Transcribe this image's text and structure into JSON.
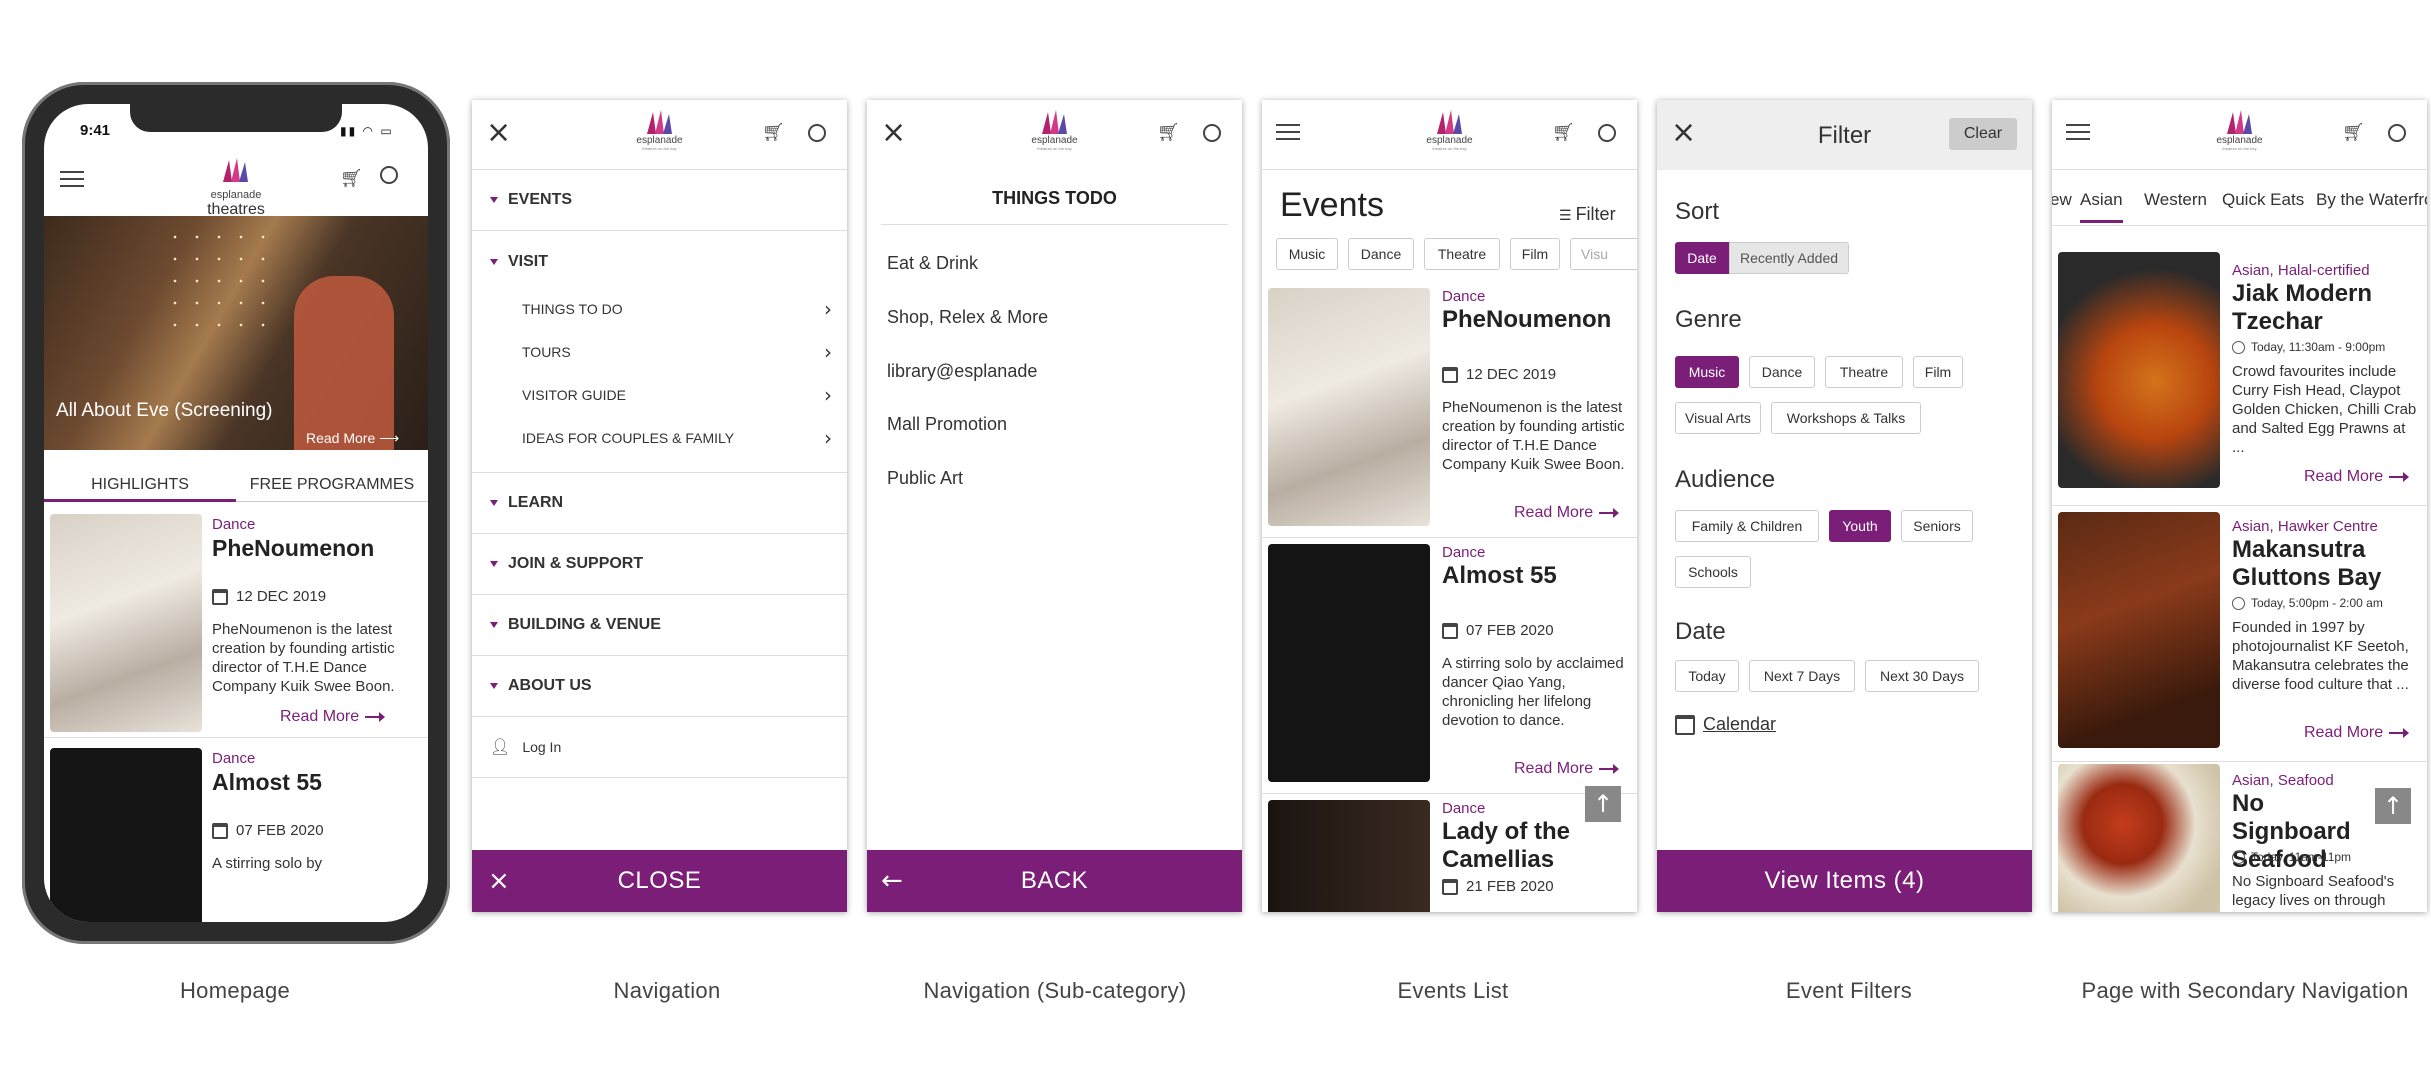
{
  "colors": {
    "accent": "#7a1e78",
    "chip_border": "#cccccc",
    "to_top": "#888888"
  },
  "logo": {
    "name": "esplanade",
    "sub1": "theatres on the bay",
    "sub2": "singapore"
  },
  "captions": [
    "Homepage",
    "Navigation",
    "Navigation (Sub-category)",
    "Events List",
    "Event Filters",
    "Page with Secondary Navigation"
  ],
  "home": {
    "status_time": "9:41",
    "hero_title": "All About Eve (Screening)",
    "hero_read_more": "Read More",
    "tabs": [
      "HIGHLIGHTS",
      "FREE PROGRAMMES"
    ],
    "cards": [
      {
        "category": "Dance",
        "title": "PheNoumenon",
        "date": "12 DEC 2019",
        "desc": "PheNoumenon is the latest creation by founding artistic director of T.H.E Dance Company Kuik Swee Boon.",
        "read_more": "Read More"
      },
      {
        "category": "Dance",
        "title": "Almost 55",
        "date": "07 FEB 2020",
        "desc": "A stirring solo by"
      }
    ]
  },
  "nav": {
    "sections": [
      "EVENTS",
      "VISIT",
      "LEARN",
      "JOIN & SUPPORT",
      "BUILDING & VENUE",
      "ABOUT US"
    ],
    "visit_items": [
      "THINGS TO DO",
      "TOURS",
      "VISITOR GUIDE",
      "IDEAS FOR COUPLES & FAMILY"
    ],
    "login": "Log In",
    "close": "CLOSE"
  },
  "subnav": {
    "title": "THINGS TODO",
    "items": [
      "Eat & Drink",
      "Shop, Relex & More",
      "library@esplanade",
      "Mall Promotion",
      "Public Art"
    ],
    "back": "BACK"
  },
  "events": {
    "title": "Events",
    "filter_label": "Filter",
    "chips": [
      "Music",
      "Dance",
      "Theatre",
      "Film",
      "Visu"
    ],
    "cards": [
      {
        "category": "Dance",
        "title": "PheNoumenon",
        "date": "12 DEC 2019",
        "desc": "PheNoumenon is the latest creation by founding artistic director of T.H.E Dance Company Kuik Swee Boon.",
        "read_more": "Read More"
      },
      {
        "category": "Dance",
        "title": "Almost 55",
        "date": "07 FEB 2020",
        "desc": "A stirring solo by acclaimed dancer Qiao Yang, chronicling her lifelong devotion to dance.",
        "read_more": "Read More"
      },
      {
        "category": "Dance",
        "title": "Lady of the Camellias",
        "date": "21 FEB 2020"
      }
    ]
  },
  "filter": {
    "title": "Filter",
    "clear": "Clear",
    "sort_title": "Sort",
    "sort": [
      "Date",
      "Recently Added"
    ],
    "genre_title": "Genre",
    "genre": [
      "Music",
      "Dance",
      "Theatre",
      "Film",
      "Visual Arts",
      "Workshops & Talks"
    ],
    "audience_title": "Audience",
    "audience": [
      "Family & Children",
      "Youth",
      "Seniors",
      "Schools"
    ],
    "date_title": "Date",
    "dates": [
      "Today",
      "Next 7 Days",
      "Next 30 Days"
    ],
    "calendar": "Calendar",
    "view": "View Items (4)"
  },
  "dining": {
    "tabs": [
      "ew",
      "Asian",
      "Western",
      "Quick Eats",
      "By the Waterfro"
    ],
    "cards": [
      {
        "category": "Asian, Halal-certified",
        "title": "Jiak Modern Tzechar",
        "time": "Today, 11:30am - 9:00pm",
        "desc": "Crowd favourites include Curry Fish Head, Claypot Golden Chicken, Chilli Crab and Salted Egg Prawns at ...",
        "read_more": "Read More"
      },
      {
        "category": "Asian, Hawker Centre",
        "title": "Makansutra Gluttons Bay",
        "time": "Today, 5:00pm - 2:00 am",
        "desc": "Founded in 1997 by photojournalist KF Seetoh, Makansutra celebrates the diverse food culture that ...",
        "read_more": "Read More"
      },
      {
        "category": "Asian, Seafood",
        "title": "No Signboard Seafood",
        "time": "Today, 11am-11pm",
        "desc": "No Signboard Seafood's legacy lives on through"
      }
    ]
  }
}
